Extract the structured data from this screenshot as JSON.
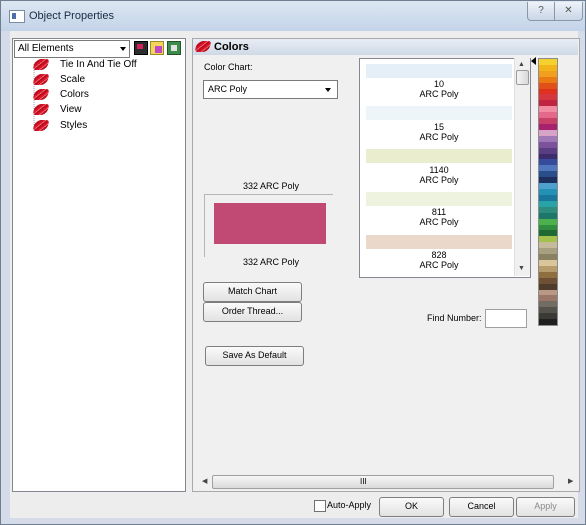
{
  "window": {
    "title": "Object Properties",
    "help_glyph": "?",
    "close_glyph": "✕"
  },
  "left_panel": {
    "filter_value": "All Elements",
    "tree": [
      {
        "label": "Tie In And Tie Off"
      },
      {
        "label": "Scale"
      },
      {
        "label": "Colors"
      },
      {
        "label": "View"
      },
      {
        "label": "Styles"
      }
    ]
  },
  "colors_panel": {
    "title": "Colors",
    "color_chart_label": "Color Chart:",
    "color_chart_value": "ARC Poly",
    "current_color_title": "332 ARC Poly",
    "current_color_name": "332 ARC Poly",
    "current_color_hex": "#c04a73",
    "match_chart_label": "Match Chart",
    "order_thread_label": "Order Thread...",
    "save_default_label": "Save As Default",
    "find_number_label": "Find Number:",
    "find_number_value": "",
    "chart_entries": [
      {
        "number": "10",
        "chart": "ARC Poly",
        "hex": "#e5eff8"
      },
      {
        "number": "15",
        "chart": "ARC Poly",
        "hex": "#edf5f8"
      },
      {
        "number": "1140",
        "chart": "ARC Poly",
        "hex": "#eaeece"
      },
      {
        "number": "811",
        "chart": "ARC Poly",
        "hex": "#edf3df"
      },
      {
        "number": "828",
        "chart": "ARC Poly",
        "hex": "#ead9cb"
      }
    ],
    "scroll_h_label": "III"
  },
  "palette": [
    "#f5d12f",
    "#f2b419",
    "#f0a01e",
    "#ea7b12",
    "#e25019",
    "#e0301e",
    "#d5363f",
    "#c02441",
    "#f08da3",
    "#e36889",
    "#c84067",
    "#a8216e",
    "#d7a4c7",
    "#a178b7",
    "#7d529c",
    "#5a3d82",
    "#3d2c6c",
    "#354c9c",
    "#5077bd",
    "#2a4e8c",
    "#1d2f5e",
    "#4ea1cc",
    "#2390b5",
    "#19779d",
    "#28a3a7",
    "#2e8c7e",
    "#1e7569",
    "#4cb04d",
    "#2f8f3f",
    "#1f6a33",
    "#a4c24b",
    "#c5ba9a",
    "#a79f80",
    "#8a8062",
    "#d9c79b",
    "#b59c6a",
    "#8f6f40",
    "#6e5134",
    "#4f3c2a",
    "#b99885",
    "#9a7768",
    "#716d63",
    "#54524c",
    "#3b3a37",
    "#202020"
  ],
  "footer": {
    "auto_apply_label": "Auto-Apply",
    "ok_label": "OK",
    "cancel_label": "Cancel",
    "apply_label": "Apply"
  }
}
